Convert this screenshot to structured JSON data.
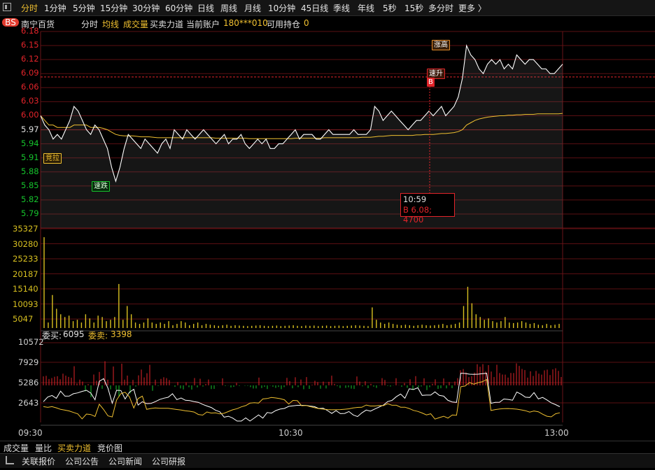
{
  "topbar": {
    "tabs": [
      "分时",
      "1分钟",
      "5分钟",
      "15分钟",
      "30分钟",
      "60分钟",
      "日线",
      "周线",
      "月线",
      "10分钟",
      "45日线",
      "季线",
      "年线",
      "5秒",
      "15秒",
      "多分时",
      "更多 〉"
    ],
    "active": "分时"
  },
  "infobar": {
    "badge": "BS",
    "stock_name": "南宁百货",
    "mode": "分时",
    "avg_line": "均线",
    "volume": "成交量",
    "buy_sell_force": "买卖力道",
    "account_label": "当前账户",
    "account_value": "180***010",
    "hold_label": "可用持仓",
    "hold_value": "0"
  },
  "price_axis": {
    "labels": [
      "6.18",
      "6.15",
      "6.12",
      "6.09",
      "6.06",
      "6.03",
      "6.00",
      "5.97",
      "5.94",
      "5.91",
      "5.88",
      "5.85",
      "5.82",
      "5.79"
    ],
    "ref_price": 5.97,
    "colors": {
      "up": "#e2242a",
      "down": "#16c42c",
      "flat": "#e0e0e0"
    }
  },
  "volume_axis": {
    "labels": [
      "35327",
      "30280",
      "25233",
      "20187",
      "15140",
      "10093",
      "5047"
    ]
  },
  "force_panel": {
    "buy_label": "委买:",
    "buy_value": "6095",
    "sell_label": "委卖:",
    "sell_value": "3398",
    "axis_labels": [
      "10572",
      "7929",
      "5286",
      "2643"
    ]
  },
  "time_axis": {
    "labels": [
      "09:30",
      "10:30",
      "13:00"
    ]
  },
  "tags": {
    "jingla": "竞拉",
    "sudie": "速跌",
    "zhanggao": "涨高",
    "sushen": "速升",
    "b_marker": "B"
  },
  "tooltip": {
    "time": "10:59",
    "detail": "B 6.08; 4700"
  },
  "bottom_tabs": [
    "成交量",
    "量比",
    "买卖力道",
    "竞价图"
  ],
  "bottom_tabs_active": "买卖力道",
  "footer_tabs": [
    "关联报价",
    "公司公告",
    "公司新闻",
    "公司研报"
  ],
  "chart_data": {
    "type": "line",
    "price": [
      6.0,
      5.98,
      5.97,
      5.95,
      5.96,
      5.95,
      5.97,
      5.99,
      6.02,
      6.01,
      5.99,
      5.97,
      5.96,
      5.98,
      5.97,
      5.95,
      5.93,
      5.89,
      5.86,
      5.89,
      5.93,
      5.96,
      5.95,
      5.94,
      5.93,
      5.95,
      5.94,
      5.93,
      5.92,
      5.94,
      5.95,
      5.93,
      5.97,
      5.96,
      5.95,
      5.97,
      5.96,
      5.95,
      5.96,
      5.97,
      5.96,
      5.95,
      5.94,
      5.95,
      5.96,
      5.94,
      5.95,
      5.95,
      5.96,
      5.94,
      5.93,
      5.94,
      5.95,
      5.94,
      5.95,
      5.93,
      5.93,
      5.94,
      5.94,
      5.95,
      5.96,
      5.97,
      5.95,
      5.96,
      5.96,
      5.96,
      5.95,
      5.95,
      5.96,
      5.97,
      5.96,
      5.96,
      5.96,
      5.96,
      5.96,
      5.97,
      5.96,
      5.96,
      5.96,
      5.97,
      6.02,
      6.01,
      5.99,
      6.0,
      6.01,
      6.0,
      5.99,
      5.98,
      5.97,
      5.98,
      5.99,
      5.99,
      6.0,
      6.01,
      6.0,
      6.01,
      6.02,
      6.0,
      6.01,
      6.02,
      6.04,
      6.08,
      6.15,
      6.13,
      6.12,
      6.1,
      6.09,
      6.11,
      6.12,
      6.11,
      6.12,
      6.1,
      6.11,
      6.1,
      6.13,
      6.12,
      6.11,
      6.12,
      6.12,
      6.11,
      6.1,
      6.1,
      6.09,
      6.09,
      6.1,
      6.11
    ],
    "avg": [
      6.0,
      5.99,
      5.98,
      5.98,
      5.975,
      5.975,
      5.975,
      5.975,
      5.98,
      5.98,
      5.98,
      5.98,
      5.975,
      5.975,
      5.975,
      5.973,
      5.97,
      5.965,
      5.96,
      5.958,
      5.957,
      5.957,
      5.957,
      5.956,
      5.955,
      5.955,
      5.955,
      5.954,
      5.953,
      5.953,
      5.953,
      5.953,
      5.953,
      5.953,
      5.953,
      5.953,
      5.953,
      5.953,
      5.953,
      5.953,
      5.953,
      5.953,
      5.952,
      5.952,
      5.952,
      5.952,
      5.952,
      5.952,
      5.952,
      5.952,
      5.951,
      5.951,
      5.951,
      5.951,
      5.951,
      5.951,
      5.951,
      5.951,
      5.951,
      5.951,
      5.951,
      5.952,
      5.952,
      5.952,
      5.952,
      5.952,
      5.952,
      5.952,
      5.953,
      5.953,
      5.953,
      5.953,
      5.953,
      5.953,
      5.953,
      5.953,
      5.953,
      5.954,
      5.954,
      5.954,
      5.955,
      5.956,
      5.956,
      5.957,
      5.958,
      5.958,
      5.958,
      5.958,
      5.958,
      5.958,
      5.959,
      5.959,
      5.96,
      5.96,
      5.96,
      5.961,
      5.962,
      5.962,
      5.963,
      5.964,
      5.966,
      5.97,
      5.98,
      5.985,
      5.99,
      5.993,
      5.995,
      5.997,
      5.998,
      5.999,
      6.0,
      6.0,
      6.001,
      6.001,
      6.002,
      6.002,
      6.003,
      6.003,
      6.003,
      6.004,
      6.004,
      6.004,
      6.004,
      6.004,
      6.004,
      6.005
    ],
    "volume": [
      33000,
      2000,
      12000,
      7000,
      5000,
      4000,
      4500,
      2500,
      3000,
      2000,
      5000,
      3500,
      2000,
      4500,
      4000,
      2500,
      3000,
      4000,
      16000,
      3000,
      8000,
      5000,
      2000,
      1500,
      2000,
      3500,
      2000,
      1500,
      2000,
      1500,
      2500,
      1000,
      1500,
      2500,
      2000,
      1000,
      1500,
      2000,
      1000,
      1500,
      1200,
      1000,
      800,
      1000,
      1200,
      800,
      1000,
      900,
      800,
      700,
      800,
      900,
      1000,
      800,
      700,
      800,
      900,
      700,
      800,
      900,
      1000,
      800,
      700,
      900,
      800,
      900,
      700,
      800,
      900,
      700,
      800,
      900,
      700,
      800,
      900,
      1000,
      900,
      800,
      700,
      7500,
      3000,
      2000,
      1500,
      2000,
      1500,
      1200,
      1000,
      1200,
      1000,
      800,
      1000,
      1200,
      1000,
      900,
      1000,
      1200,
      1500,
      1000,
      1200,
      1500,
      2000,
      8000,
      15000,
      9000,
      5000,
      4000,
      3000,
      3500,
      2500,
      2000,
      2500,
      4000,
      2000,
      1800,
      2000,
      2500,
      2000,
      1500,
      1800,
      1200,
      1000,
      1500,
      1000,
      1200,
      1500
    ],
    "ylim": [
      5.79,
      6.18
    ],
    "x_labels": [
      "09:30",
      "10:30",
      "13:00"
    ]
  }
}
